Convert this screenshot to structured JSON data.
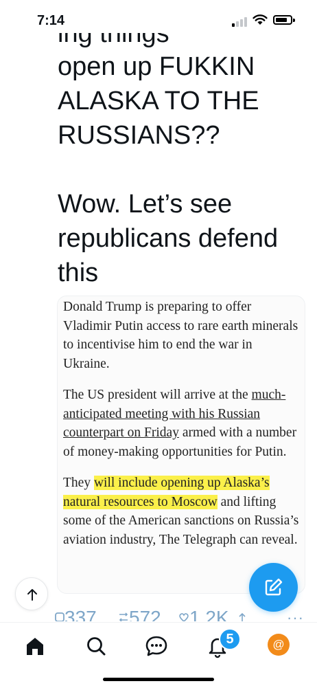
{
  "status_bar": {
    "time": "7:14"
  },
  "post": {
    "clipped_top_line": "ing things",
    "lines": [
      "open up FUKKIN",
      "ALASKA TO THE",
      "RUSSIANS??",
      "",
      "Wow.  Let’s see",
      "republicans defend",
      "this"
    ]
  },
  "article": {
    "paragraph_1": "Donald Trump is preparing to offer Vladimir Putin access to rare earth minerals to incentivise him to end the war in Ukraine.",
    "paragraph_2_pre": "The US president will arrive at the ",
    "paragraph_2_link": "much-anticipated meeting with his Russian counterpart on Friday",
    "paragraph_2_post": " armed with a number of money-making opportunities for Putin.",
    "paragraph_3_pre": "They ",
    "paragraph_3_highlight": "will include opening up Alaska’s natural resources to Moscow",
    "paragraph_3_post": " and lifting some of the American sanctions on Russia’s aviation industry, The Telegraph can reveal."
  },
  "actions": {
    "reply_count": "337",
    "retweet_count": "572",
    "like_count": "1.2K",
    "more": "···"
  },
  "nav": {
    "notifications_badge": "5",
    "avatar_letter": "@"
  },
  "colors": {
    "accent": "#1d9bf0",
    "highlight": "#fbf04a",
    "avatar": "#f28b1a"
  },
  "icons": [
    "signal-icon",
    "wifi-icon",
    "battery-icon",
    "arrow-up-icon",
    "compose-icon",
    "reply-icon",
    "retweet-icon",
    "like-icon",
    "share-icon",
    "home-icon",
    "search-icon",
    "messages-icon",
    "bell-icon"
  ]
}
